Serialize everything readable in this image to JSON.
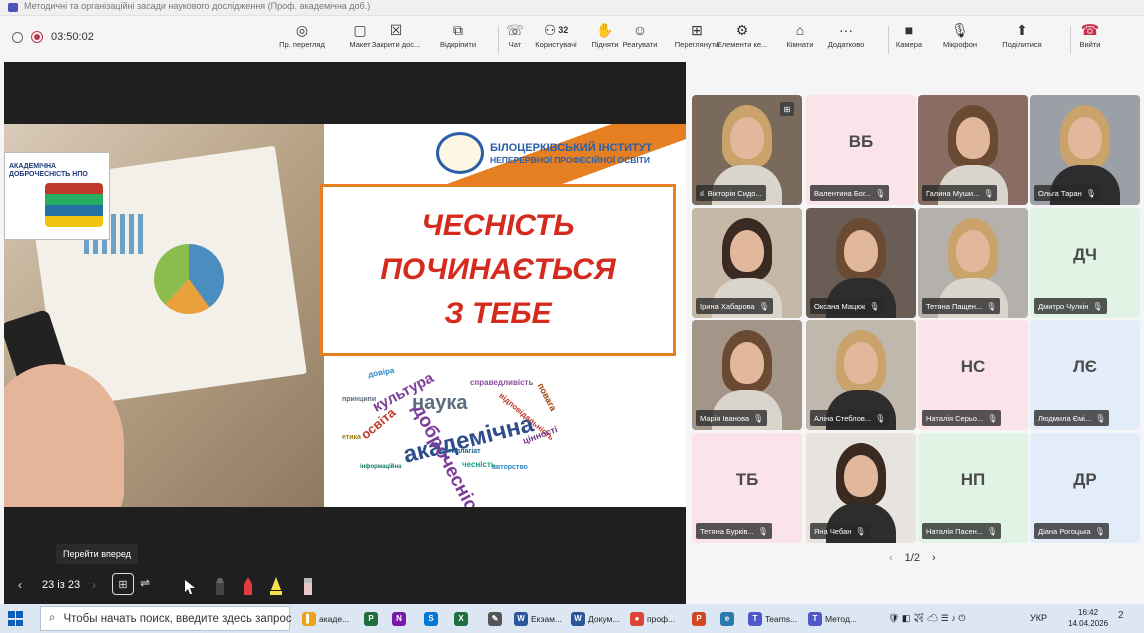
{
  "window": {
    "title": "Методичні та організаційні засади наукового дослідження (Проф. академічна доб.)"
  },
  "toolbar": {
    "timer": "03:50:02",
    "buttons": [
      {
        "label": "Пр. перегляд",
        "icon": "eye-icon",
        "glyph": "◎"
      },
      {
        "label": "Макет",
        "icon": "layout-icon",
        "glyph": "▢"
      },
      {
        "label": "Закрити дос...",
        "icon": "close-share-icon",
        "glyph": "☒"
      },
      {
        "label": "Відкріпити",
        "icon": "popout-icon",
        "glyph": "⧉"
      },
      {
        "label": "Чат",
        "icon": "chat-icon",
        "glyph": "☏"
      },
      {
        "label": "Користувачі",
        "icon": "people-icon",
        "glyph": "⚇",
        "badge": "32"
      },
      {
        "label": "Підняти",
        "icon": "raise-hand-icon",
        "glyph": "✋"
      },
      {
        "label": "Реагувати",
        "icon": "react-icon",
        "glyph": "☺"
      },
      {
        "label": "Переглянути",
        "icon": "view-icon",
        "glyph": "⊞"
      },
      {
        "label": "Елементи ке...",
        "icon": "host-tools-icon",
        "glyph": "⚙"
      },
      {
        "label": "Кімнати",
        "icon": "rooms-icon",
        "glyph": "⌂"
      },
      {
        "label": "Додатково",
        "icon": "more-icon",
        "glyph": "···"
      },
      {
        "label": "Камера",
        "icon": "camera-icon",
        "glyph": "■"
      },
      {
        "label": "Мікрофон",
        "icon": "microphone-icon",
        "glyph": "🎙"
      },
      {
        "label": "Поділитися",
        "icon": "share-icon",
        "glyph": "⬆"
      },
      {
        "label": "Вийти",
        "icon": "leave-call-icon",
        "glyph": "☎"
      }
    ]
  },
  "slide": {
    "logo_text": "АКАДЕМІЧНА ДОБРОЧЕСНІСТЬ НПО",
    "institute_line1": "БІЛОЦЕРКІВСЬКИЙ ІНСТИТУТ",
    "institute_line2": "НЕПЕРЕРВНОЇ ПРОФЕСІЙНОЇ ОСВІТИ",
    "headline": [
      "ЧЕСНІСТЬ",
      "ПОЧИНАЄТЬСЯ",
      "З ТЕБЕ"
    ],
    "word_cloud": [
      {
        "text": "академічна",
        "color": "#2e4d8c"
      },
      {
        "text": "доброчесність",
        "color": "#7d3c98"
      },
      {
        "text": "наука",
        "color": "#5d6d7e"
      },
      {
        "text": "культура",
        "color": "#7d3c98"
      },
      {
        "text": "освіта",
        "color": "#c0392b"
      },
      {
        "text": "справедливість",
        "color": "#884ea0"
      },
      {
        "text": "авторство",
        "color": "#2e86c1"
      },
      {
        "text": "повага",
        "color": "#a04000"
      },
      {
        "text": "чесність",
        "color": "#16a085"
      },
      {
        "text": "відповідальність",
        "color": "#c0392b"
      },
      {
        "text": "принципи",
        "color": "#5d6d7e"
      },
      {
        "text": "антиплагіат",
        "color": "#1f618d"
      },
      {
        "text": "довіра",
        "color": "#2e86c1"
      },
      {
        "text": "інформаційна",
        "color": "#117a65"
      },
      {
        "text": "етика",
        "color": "#9a7d0a"
      },
      {
        "text": "цінності",
        "color": "#6c3483"
      }
    ]
  },
  "controls": {
    "tooltip": "Перейти вперед",
    "page": "23 із 23",
    "prev": "‹",
    "next": "›"
  },
  "participants": [
    {
      "name": "Вікторія Сидо...",
      "type": "video",
      "signal": "ıl"
    },
    {
      "name": "Валентина Бог...",
      "type": "avatar",
      "initials": "ВБ",
      "bg": "#fbe3ea"
    },
    {
      "name": "Галина Муши...",
      "type": "video"
    },
    {
      "name": "Ольга Таран",
      "type": "video"
    },
    {
      "name": "Ірина Хабарова",
      "type": "video"
    },
    {
      "name": "Оксана Мацюк",
      "type": "video"
    },
    {
      "name": "Тетяна Пащен...",
      "type": "video"
    },
    {
      "name": "Дмитро Чулкін",
      "type": "avatar",
      "initials": "ДЧ",
      "bg": "#e1f3e4"
    },
    {
      "name": "Марія Іванова",
      "type": "video"
    },
    {
      "name": "Аліна Стеблов...",
      "type": "video"
    },
    {
      "name": "Наталія Серьо...",
      "type": "avatar",
      "initials": "НС",
      "bg": "#fbe3ea"
    },
    {
      "name": "Людмила Ємі...",
      "type": "avatar",
      "initials": "ЛЄ",
      "bg": "#e3ecf9"
    },
    {
      "name": "Тетяна Бурків...",
      "type": "avatar",
      "initials": "ТБ",
      "bg": "#fbe3ea"
    },
    {
      "name": "Яна Чебан",
      "type": "video"
    },
    {
      "name": "Наталія Пасен...",
      "type": "avatar",
      "initials": "НП",
      "bg": "#e1f3e4"
    },
    {
      "name": "Діана Рогоцька",
      "type": "avatar",
      "initials": "ДР",
      "bg": "#e3ecf9"
    }
  ],
  "pager": {
    "text": "1/2",
    "prev": "‹",
    "next": "›"
  },
  "taskbar": {
    "search_placeholder": "Чтобы начать поиск, введите здесь запрос",
    "items": [
      {
        "label": "акаде...",
        "color": "#e8a317",
        "glyph": "▌"
      },
      {
        "label": "",
        "color": "#1e6e3c",
        "glyph": "P"
      },
      {
        "label": "",
        "color": "#7719aa",
        "glyph": "N"
      },
      {
        "label": "",
        "color": "#0078d4",
        "glyph": "S"
      },
      {
        "label": "",
        "color": "#1d6f42",
        "glyph": "X"
      },
      {
        "label": "",
        "color": "#555555",
        "glyph": "✎"
      },
      {
        "label": "Екзам...",
        "color": "#2b579a",
        "glyph": "W"
      },
      {
        "label": "Докум...",
        "color": "#2b579a",
        "glyph": "W"
      },
      {
        "label": "проф...",
        "color": "#db4437",
        "glyph": "●"
      },
      {
        "label": "",
        "color": "#d24726",
        "glyph": "P"
      },
      {
        "label": "",
        "color": "#2a7ab0",
        "glyph": "e"
      },
      {
        "label": "Teams...",
        "color": "#5059c9",
        "glyph": "T"
      },
      {
        "label": "Метод...",
        "color": "#5059c9",
        "glyph": "T"
      }
    ],
    "lang": "УКР",
    "time": "16:42",
    "date": "14.04.2026",
    "notifications": "2"
  }
}
